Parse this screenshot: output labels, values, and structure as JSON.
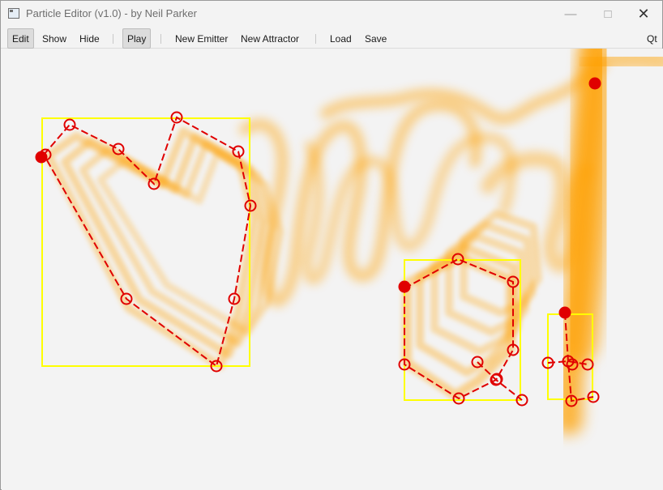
{
  "window": {
    "title": "Particle Editor (v1.0) - by Neil Parker",
    "minimize_glyph": "—",
    "maximize_glyph": "□",
    "close_glyph": "✕"
  },
  "toolbar": {
    "edit_label": "Edit",
    "show_label": "Show",
    "hide_label": "Hide",
    "play_label": "Play",
    "new_emitter_label": "New Emitter",
    "new_attractor_label": "New Attractor",
    "load_label": "Load",
    "save_label": "Save",
    "qt_label": "Qt"
  },
  "colors": {
    "particle": "#ffa000",
    "bounds": "#ffff00",
    "path": "#e00000",
    "handle": "#e00000"
  },
  "icons": {
    "app": "app-window-icon"
  }
}
